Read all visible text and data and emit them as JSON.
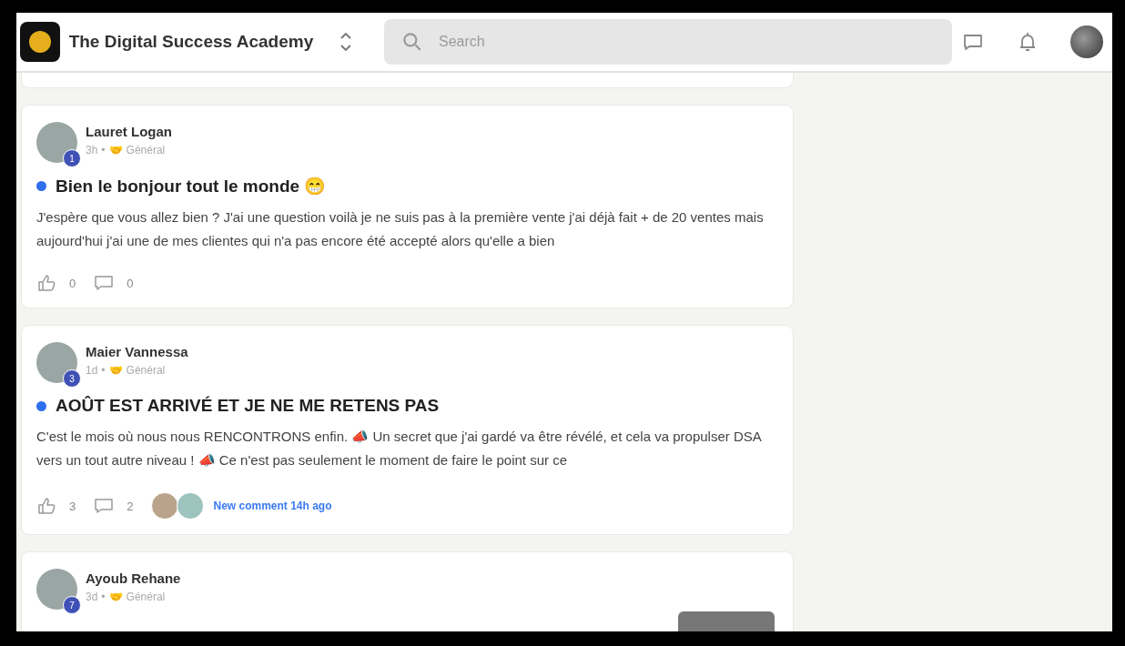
{
  "header": {
    "community_name": "The Digital Success Academy",
    "search": {
      "placeholder": "Search"
    }
  },
  "posts": [
    {
      "author": "Lauret Logan",
      "level_badge": "1",
      "time": "3h",
      "separator": "•",
      "category_emoji": "🤝",
      "category": "Général",
      "unread": true,
      "title": "Bien le bonjour tout le monde 😁",
      "body": "J'espère que vous allez bien ? J'ai une question voilà je ne suis pas à la première vente j'ai déjà fait + de 20 ventes mais aujourd'hui j'ai une de mes clientes qui n'a pas encore été accepté alors qu'elle a bien",
      "likes": "0",
      "comments": "0"
    },
    {
      "author": "Maier Vannessa",
      "level_badge": "3",
      "time": "1d",
      "separator": "•",
      "category_emoji": "🤝",
      "category": "Général",
      "unread": true,
      "title": "AOÛT EST ARRIVÉ ET JE NE ME RETENS PAS",
      "body": "C'est le mois où nous nous RENCONTRONS enfin. 📣 Un secret que j'ai gardé va être révélé, et cela va propulser DSA vers un tout autre niveau ! 📣 Ce n'est pas seulement le moment de faire le point sur ce",
      "likes": "3",
      "comments": "2",
      "commenters": [
        {
          "color": "#b9a38a"
        },
        {
          "color": "#9cc3bd"
        }
      ],
      "new_comment": "New comment 14h ago"
    },
    {
      "author": "Ayoub Rehane",
      "level_badge": "7",
      "time": "3d",
      "separator": "•",
      "category_emoji": "🤝",
      "category": "Général",
      "has_thumbnail": true
    }
  ]
}
